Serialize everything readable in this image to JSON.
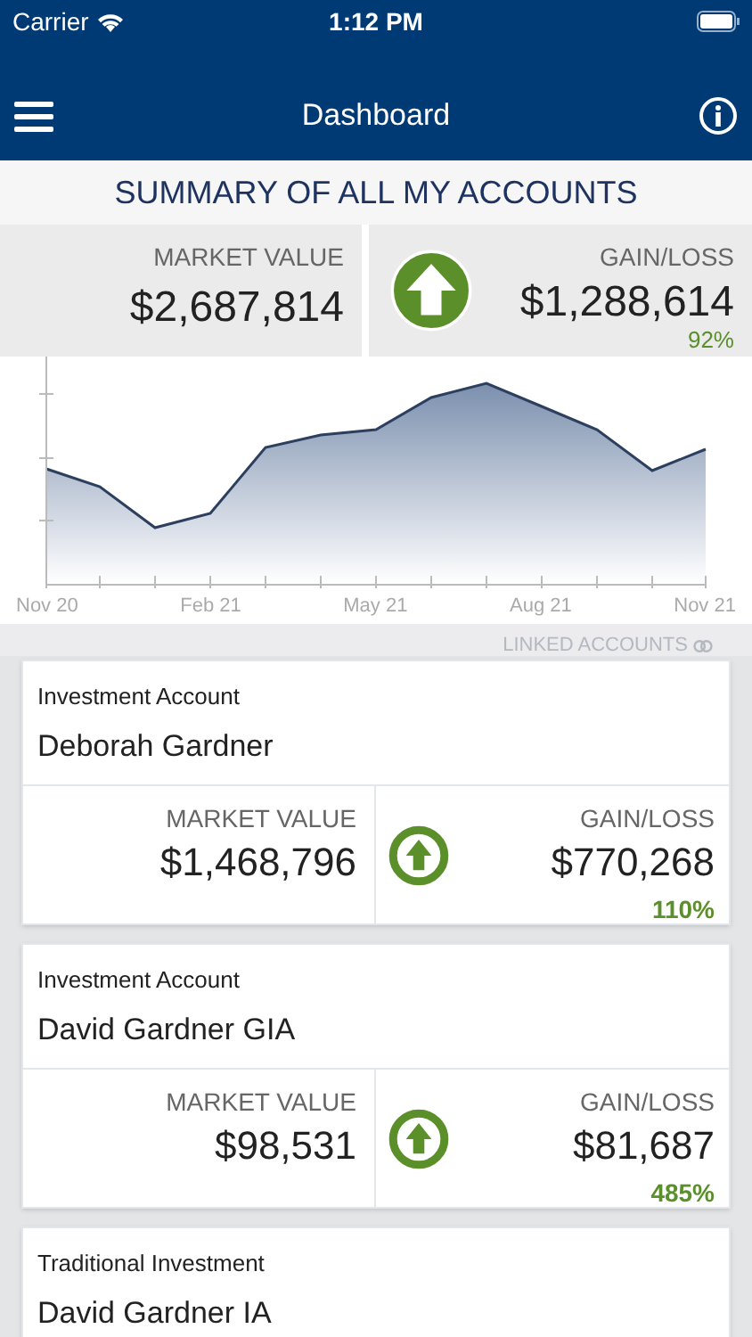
{
  "status_bar": {
    "carrier": "Carrier",
    "time": "1:12 PM"
  },
  "nav": {
    "title": "Dashboard"
  },
  "summary": {
    "title": "SUMMARY OF ALL MY ACCOUNTS",
    "market_label": "MARKET VALUE",
    "market_value": "$2,687,814",
    "gain_label": "GAIN/LOSS",
    "gain_value": "$1,288,614",
    "gain_percent": "92%",
    "kind": "gain"
  },
  "chart": {
    "x_labels": [
      "Nov 20",
      "Feb 21",
      "May 21",
      "Aug 21",
      "Nov 21"
    ]
  },
  "linked_label": "LINKED ACCOUNTS",
  "accounts": [
    {
      "type": "Investment Account",
      "name": "Deborah Gardner",
      "market_label": "MARKET VALUE",
      "market_value": "$1,468,796",
      "gain_label": "GAIN/LOSS",
      "gain_value": "$770,268",
      "gain_percent": "110%",
      "kind": "gain"
    },
    {
      "type": "Investment Account",
      "name": "David Gardner GIA",
      "market_label": "MARKET VALUE",
      "market_value": "$98,531",
      "gain_label": "GAIN/LOSS",
      "gain_value": "$81,687",
      "gain_percent": "485%",
      "kind": "gain"
    },
    {
      "type": "Traditional Investment",
      "name": "David Gardner IA"
    }
  ]
}
